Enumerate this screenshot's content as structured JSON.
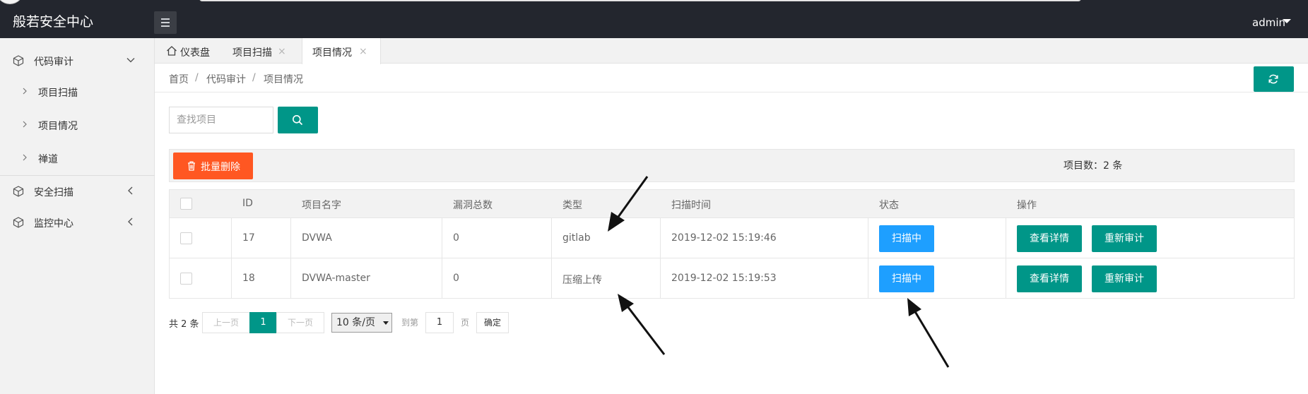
{
  "app": {
    "title": "般若安全中心",
    "user": "admin"
  },
  "sidebar": {
    "groups": [
      {
        "label": "代码审计",
        "expanded": true,
        "items": [
          {
            "label": "项目扫描"
          },
          {
            "label": "项目情况"
          },
          {
            "label": "禅道"
          }
        ]
      },
      {
        "label": "安全扫描",
        "expanded": false
      },
      {
        "label": "监控中心",
        "expanded": false
      }
    ]
  },
  "tabs": [
    {
      "label": "仪表盘",
      "closable": false,
      "active": false
    },
    {
      "label": "项目扫描",
      "closable": true,
      "active": false
    },
    {
      "label": "项目情况",
      "closable": true,
      "active": true
    }
  ],
  "tab_close_glyph": "×",
  "breadcrumb": {
    "items": [
      "首页",
      "代码审计",
      "项目情况"
    ],
    "separator": "/"
  },
  "search": {
    "placeholder": "查找项目",
    "value": ""
  },
  "toolbar": {
    "batch_delete_label": "批量删除",
    "count_label": "项目数：2 条"
  },
  "table": {
    "headers": [
      "ID",
      "项目名字",
      "漏洞总数",
      "类型",
      "扫描时间",
      "状态",
      "操作"
    ],
    "rows": [
      {
        "id": "17",
        "name": "DVWA",
        "vulns": "0",
        "type": "gitlab",
        "time": "2019-12-02 15:19:46",
        "status": "扫描中"
      },
      {
        "id": "18",
        "name": "DVWA-master",
        "vulns": "0",
        "type": "压缩上传",
        "time": "2019-12-02 15:19:53",
        "status": "扫描中"
      }
    ],
    "actions": {
      "view": "查看详情",
      "reaudit": "重新审计"
    }
  },
  "pagination": {
    "total": "共 2 条",
    "prev": "上一页",
    "current": "1",
    "next": "下一页",
    "page_size": "10 条/页",
    "goto_prefix": "到第",
    "goto_value": "1",
    "goto_suffix": "页",
    "confirm": "确定"
  },
  "colors": {
    "header": "#23262e",
    "primary": "#009688",
    "danger": "#ff5722",
    "status": "#1e9fff"
  }
}
